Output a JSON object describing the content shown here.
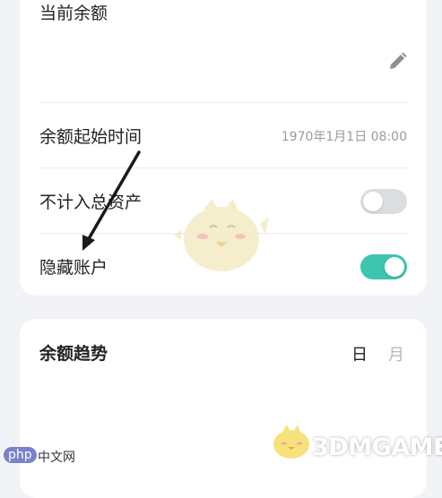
{
  "balance": {
    "label": "当前余额"
  },
  "settings": {
    "start_time_label": "余额起始时间",
    "start_time_value": "1970年1月1日 08:00",
    "exclude_total_label": "不计入总资产",
    "exclude_total_on": false,
    "hide_account_label": "隐藏账户",
    "hide_account_on": true
  },
  "trend": {
    "title": "余额趋势",
    "seg_day": "日",
    "seg_month": "月"
  },
  "watermarks": {
    "php_badge": "php",
    "php_text": "中文网",
    "site": "3DMGAME"
  },
  "colors": {
    "accent": "#3fc4b0",
    "toggle_off": "#dcdde1",
    "background": "#f2f3f7",
    "card": "#ffffff"
  },
  "icons": {
    "edit": "pencil-icon"
  }
}
